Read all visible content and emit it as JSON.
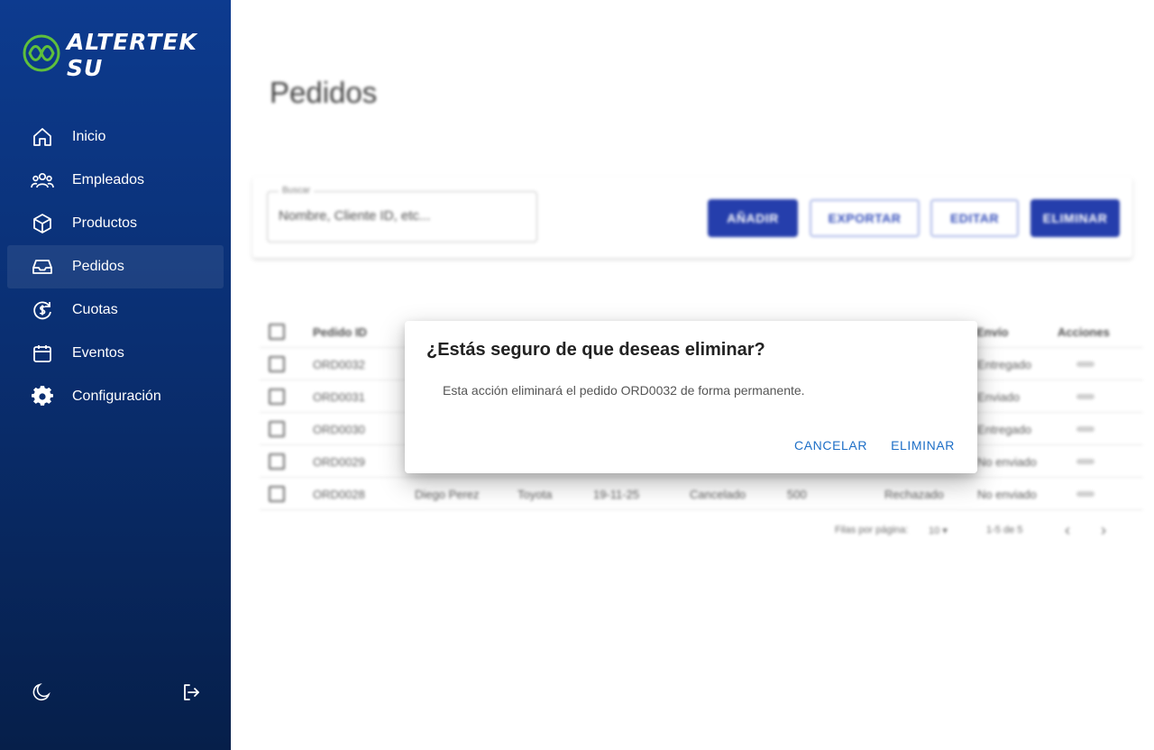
{
  "app": {
    "name": "ALTERTEK SU"
  },
  "sidebar": {
    "items": [
      {
        "label": "Inicio",
        "icon": "home-icon"
      },
      {
        "label": "Empleados",
        "icon": "users-icon"
      },
      {
        "label": "Productos",
        "icon": "cube-icon"
      },
      {
        "label": "Pedidos",
        "icon": "inbox-icon",
        "active": true
      },
      {
        "label": "Cuotas",
        "icon": "dollar-cycle-icon"
      },
      {
        "label": "Eventos",
        "icon": "calendar-icon"
      },
      {
        "label": "Configuración",
        "icon": "gear-icon"
      }
    ],
    "footer": {
      "theme_icon": "moon-icon",
      "logout_icon": "logout-icon"
    }
  },
  "page": {
    "title": "Pedidos"
  },
  "toolbar": {
    "search_label": "Buscar",
    "search_placeholder": "Nombre, Cliente ID, etc...",
    "add_label": "AÑADIR",
    "export_label": "EXPORTAR",
    "edit_label": "EDITAR",
    "delete_label": "ELIMINAR"
  },
  "table": {
    "headers": {
      "id": "Pedido ID",
      "envio": "Envío",
      "acciones": "Acciones"
    },
    "rows": [
      {
        "id": "ORD0032",
        "envio": "Entregado"
      },
      {
        "id": "ORD0031",
        "envio": "Enviado"
      },
      {
        "id": "ORD0030",
        "envio": "Entregado"
      },
      {
        "id": "ORD0029",
        "envio": "No enviado"
      },
      {
        "id": "ORD0028",
        "cliente": "Diego Perez",
        "producto": "Toyota",
        "fecha": "19-11-25",
        "estado": "Cancelado",
        "monto": "500",
        "pago": "Rechazado",
        "envio": "No enviado"
      }
    ]
  },
  "pagination": {
    "rows_label": "Filas por página:",
    "rows_value": "10",
    "range": "1-5 de 5"
  },
  "dialog": {
    "title": "¿Estás seguro de que deseas eliminar?",
    "message": "Esta acción eliminará el pedido ORD0032 de forma permanente.",
    "cancel_label": "CANCELAR",
    "confirm_label": "ELIMINAR"
  },
  "colors": {
    "sidebar_top": "#0d3b8f",
    "sidebar_bottom": "#061f4a",
    "primary": "#1a34a8",
    "dialog_action": "#1e6fc7",
    "logo_accent": "#5fbf3c"
  }
}
